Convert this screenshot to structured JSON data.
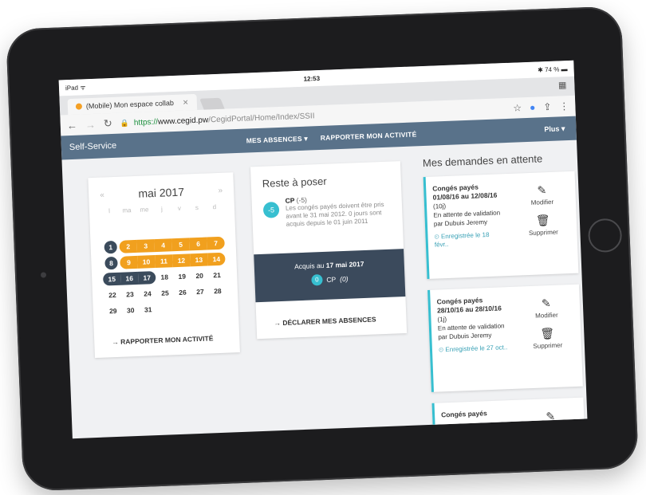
{
  "status": {
    "left": "iPad ᯤ",
    "time": "12:53",
    "battery": "74 %"
  },
  "browser": {
    "tab_title": "(Mobile) Mon espace collab",
    "url_scheme": "https://",
    "url_host": "www.cegid.pw",
    "url_path": "/CegidPortal/Home/Index/SSII"
  },
  "app": {
    "brand": "Self-Service",
    "menu_absences": "MES ABSENCES ▾",
    "menu_activite": "RAPPORTER MON ACTIVITÉ",
    "menu_plus": "Plus ▾"
  },
  "calendar": {
    "month": "mai 2017",
    "prev": "«",
    "next": "»",
    "day_names": [
      "l",
      "ma",
      "me",
      "j",
      "v",
      "s",
      "d"
    ],
    "weeks": [
      [
        "1",
        "2",
        "3",
        "4",
        "5",
        "6",
        "7"
      ],
      [
        "8",
        "9",
        "10",
        "11",
        "12",
        "13",
        "14"
      ],
      [
        "15",
        "16",
        "17",
        "18",
        "19",
        "20",
        "21"
      ],
      [
        "22",
        "23",
        "24",
        "25",
        "26",
        "27",
        "28"
      ],
      [
        "29",
        "30",
        "31",
        "",
        "",
        "",
        ""
      ]
    ],
    "action": "→  RAPPORTER MON ACTIVITÉ"
  },
  "remaining": {
    "title": "Reste à poser",
    "badge": "-5",
    "cp_label": "CP",
    "cp_value": "(-5)",
    "note": "Les congés payés doivent être pris avant le 31 mai 2012. 0 jours sont acquis depuis le 01 juin 2011",
    "acquired_label": "Acquis au",
    "acquired_date": "17 mai 2017",
    "acquired_badge": "0",
    "acquired_cp": "CP",
    "acquired_value": "(0)",
    "action": "→  DÉCLARER MES ABSENCES"
  },
  "pending": {
    "title": "Mes demandes en attente",
    "requests": [
      {
        "type": "Congés payés",
        "dates": "01/08/16 au 12/08/16",
        "duration": "(10j)",
        "status": "En attente de validation par Dubuis Jeremy",
        "registered": "Enregistrée le 18 févr..",
        "edit": "Modifier",
        "delete": "Supprimer"
      },
      {
        "type": "Congés payés",
        "dates": "28/10/16 au 28/10/16",
        "duration": "(1j)",
        "status": "En attente de validation par Dubuis Jeremy",
        "registered": "Enregistrée le 27 oct..",
        "edit": "Modifier",
        "delete": "Supprimer"
      },
      {
        "type": "Congés payés"
      }
    ]
  }
}
